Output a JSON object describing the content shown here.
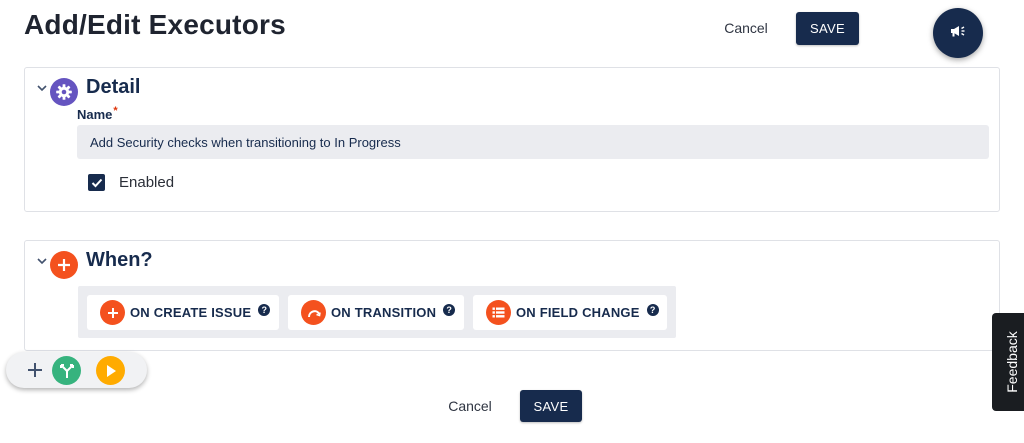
{
  "page": {
    "title": "Add/Edit Executors"
  },
  "header": {
    "cancel_label": "Cancel",
    "save_label": "SAVE",
    "announcement_icon": "megaphone-icon"
  },
  "detail": {
    "title": "Detail",
    "icon": "gear-icon",
    "name_label": "Name",
    "required_marker": "*",
    "name_value": "Add Security checks when transitioning to In Progress",
    "enabled_label": "Enabled",
    "enabled_checked": true
  },
  "when": {
    "title": "When?",
    "icon": "plus-circle-icon",
    "triggers": [
      {
        "label": "ON CREATE ISSUE",
        "icon": "plus-icon",
        "help": "?"
      },
      {
        "label": "ON TRANSITION",
        "icon": "curved-arrow-icon",
        "help": "?"
      },
      {
        "label": "ON FIELD CHANGE",
        "icon": "list-icon",
        "help": "?"
      }
    ]
  },
  "footer": {
    "cancel_label": "Cancel",
    "save_label": "SAVE"
  },
  "floating_toolbar": {
    "items": [
      "plus-icon",
      "branch-icon",
      "play-icon"
    ]
  },
  "feedback": {
    "label": "Feedback"
  },
  "colors": {
    "primary": "#172b4d",
    "accent_orange": "#f4511e",
    "detail_icon_purple": "#6554c0",
    "branch_green": "#36b37e",
    "play_yellow": "#ffab00",
    "input_bg": "#ebecf0"
  }
}
